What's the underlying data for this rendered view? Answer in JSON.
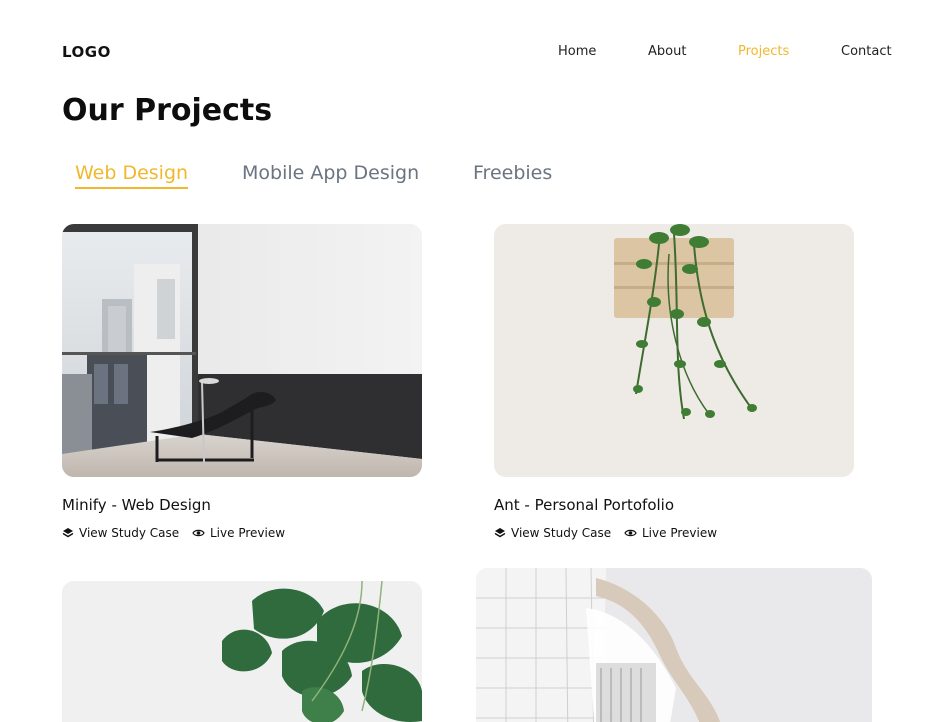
{
  "header": {
    "logo": "LOGO",
    "nav": [
      {
        "label": "Home",
        "active": false
      },
      {
        "label": "About",
        "active": false
      },
      {
        "label": "Projects",
        "active": true
      },
      {
        "label": "Contact",
        "active": false
      }
    ]
  },
  "main": {
    "title": "Our Projects",
    "tabs": [
      {
        "label": "Web Design",
        "active": true
      },
      {
        "label": "Mobile App Design",
        "active": false
      },
      {
        "label": "Freebies",
        "active": false
      }
    ],
    "projects": [
      {
        "title": "Minify - Web Design",
        "study_label": "View Study Case",
        "preview_label": "Live Preview",
        "image": "interior-lounge-chair-photo"
      },
      {
        "title": "Ant - Personal Portofolio",
        "study_label": "View Study Case",
        "preview_label": "Live Preview",
        "image": "hanging-ivy-plant-photo"
      },
      {
        "image": "monstera-plant-photo"
      },
      {
        "image": "curved-architecture-photo"
      }
    ]
  },
  "colors": {
    "accent": "#f0b92d",
    "tab_inactive": "#6b7480",
    "text": "#111111",
    "background": "#ffffff"
  },
  "icons": {
    "study": "layers-icon",
    "preview": "eye-icon"
  }
}
